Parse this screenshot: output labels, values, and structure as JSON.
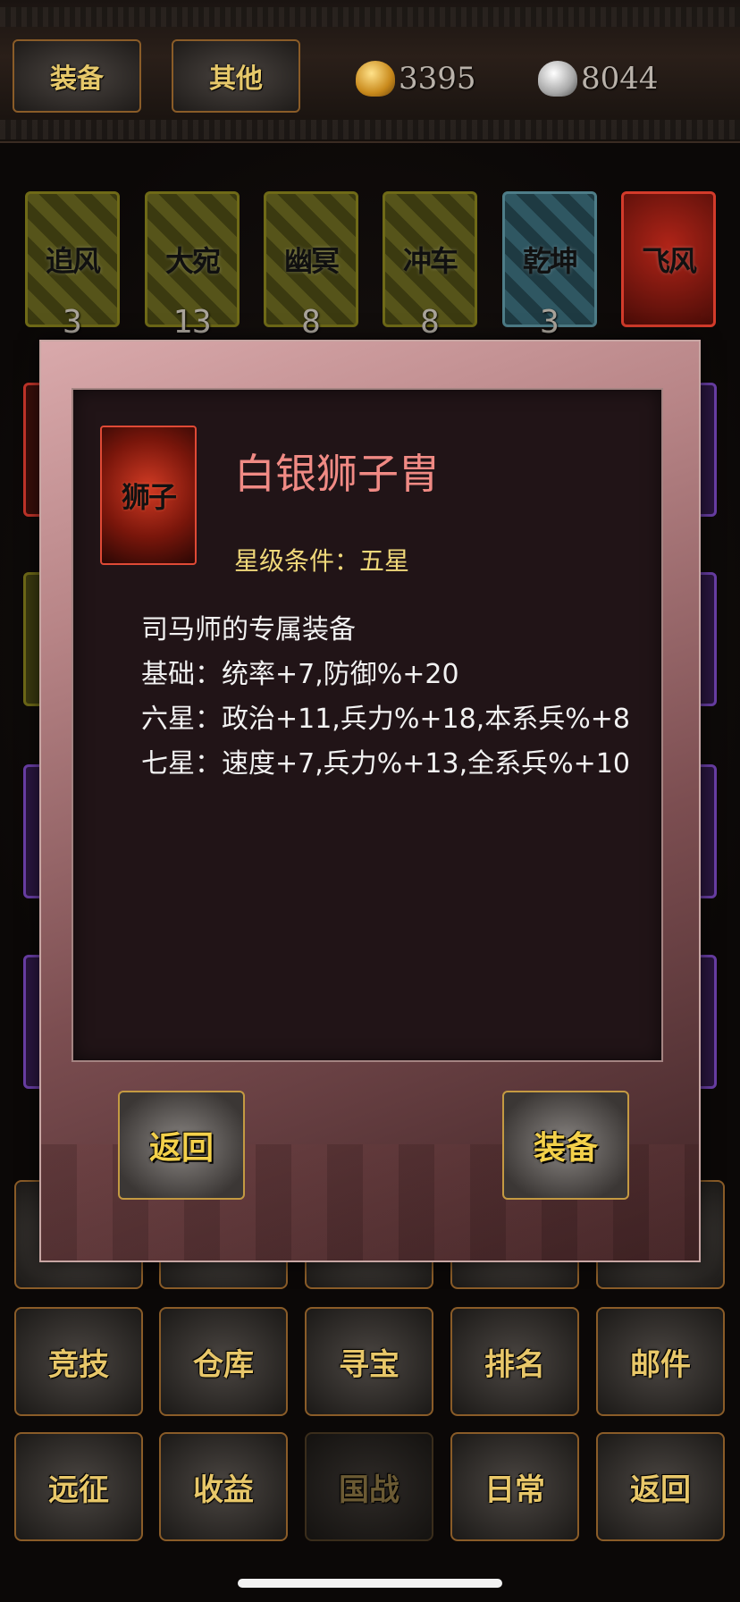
{
  "topbar": {
    "tab_equip": "装备",
    "tab_other": "其他",
    "gold": "3395",
    "silver": "8044"
  },
  "cards": [
    {
      "label": "追风",
      "count": "3",
      "color": "yellow"
    },
    {
      "label": "大宛",
      "count": "13",
      "color": "yellow"
    },
    {
      "label": "幽冥",
      "count": "8",
      "color": "yellow"
    },
    {
      "label": "冲车",
      "count": "8",
      "color": "yellow"
    },
    {
      "label": "乾坤",
      "count": "3",
      "color": "blue"
    },
    {
      "label": "飞风",
      "count": "",
      "color": "red"
    }
  ],
  "modal": {
    "icon_label": "狮子",
    "name": "白银狮子胄",
    "condition": "星级条件：五星",
    "desc": [
      "司马师的专属装备",
      "基础：统率+7,防御%+20",
      "六星：政治+11,兵力%+18,本系兵%+8",
      "七星：速度+7,兵力%+13,全系兵%+10"
    ],
    "back_label": "返回",
    "equip_label": "装备"
  },
  "menu": {
    "row1": [
      "竞技",
      "仓库",
      "寻宝",
      "排名",
      "邮件"
    ],
    "row2": [
      "远征",
      "收益",
      "国战",
      "日常",
      "返回"
    ]
  }
}
